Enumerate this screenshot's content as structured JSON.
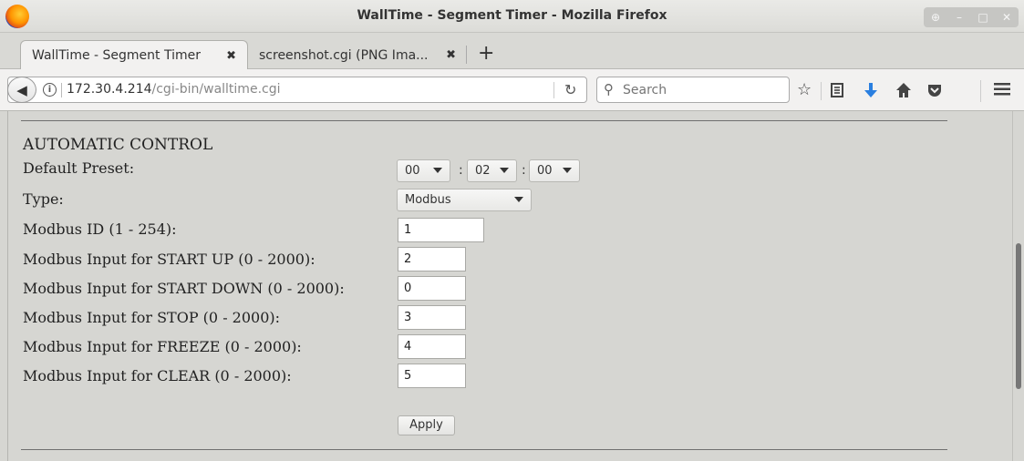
{
  "window": {
    "title": "WallTime - Segment Timer - Mozilla Firefox",
    "controls": [
      "⊕",
      "–",
      "□",
      "✕"
    ]
  },
  "tabs": [
    {
      "label": "WallTime - Segment Timer",
      "close": "✖"
    },
    {
      "label": "screenshot.cgi (PNG Ima...",
      "close": "✖"
    }
  ],
  "new_tab_label": "+",
  "urlbar": {
    "host": "172.30.4.214",
    "path": "/cgi-bin/walltime.cgi"
  },
  "search": {
    "placeholder": "Search"
  },
  "toolbar_icons": [
    "star-icon",
    "reading-list-icon",
    "download-icon",
    "home-icon",
    "pocket-icon",
    "menu-icon"
  ],
  "form": {
    "section_title": "AUTOMATIC CONTROL",
    "default_preset_label": "Default Preset:",
    "preset": {
      "hours": "00",
      "minutes": "02",
      "seconds": "00",
      "separator": ":"
    },
    "type_label": "Type:",
    "type_value": "Modbus",
    "fields": [
      {
        "label": "Modbus ID (1 - 254):",
        "value": "1"
      },
      {
        "label": "Modbus Input for START UP (0 - 2000):",
        "value": "2"
      },
      {
        "label": "Modbus Input for START DOWN (0 - 2000):",
        "value": "0"
      },
      {
        "label": "Modbus Input for STOP (0 - 2000):",
        "value": "3"
      },
      {
        "label": "Modbus Input for FREEZE (0 - 2000):",
        "value": "4"
      },
      {
        "label": "Modbus Input for CLEAR (0 - 2000):",
        "value": "5"
      }
    ],
    "apply_label": "Apply"
  }
}
